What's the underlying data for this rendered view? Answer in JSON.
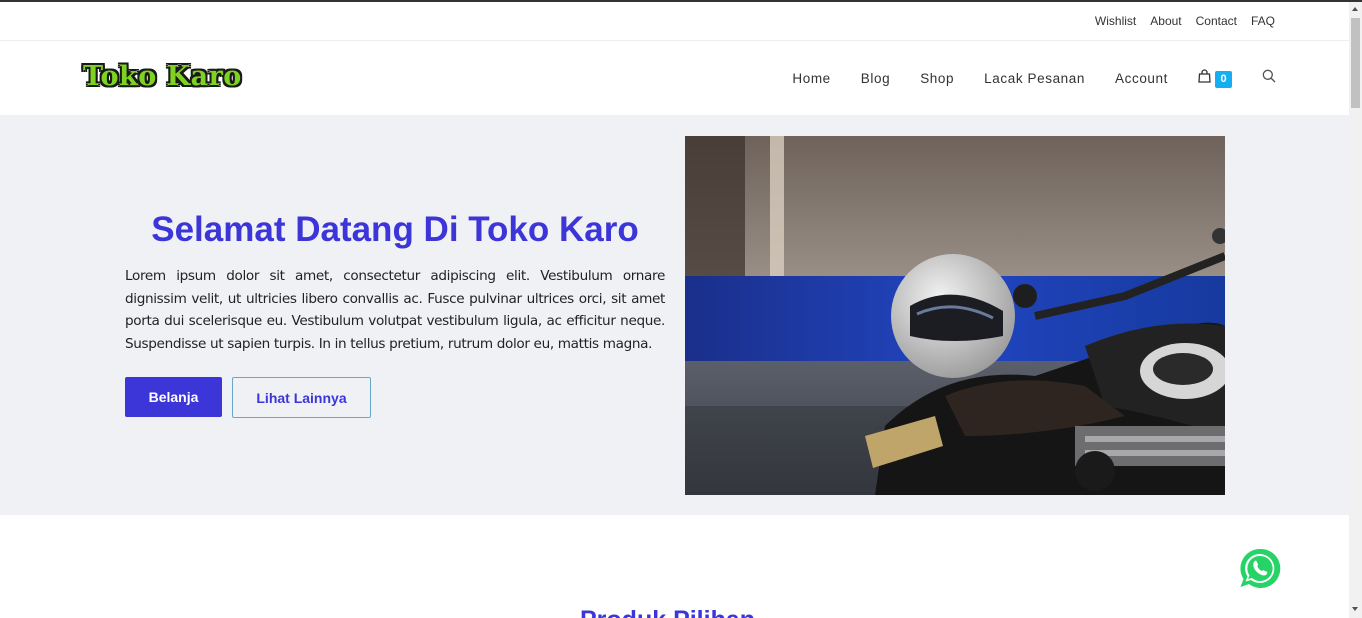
{
  "topbar": {
    "links": [
      "Wishlist",
      "About",
      "Contact",
      "FAQ"
    ]
  },
  "header": {
    "logo_text": "Toko Karo",
    "nav": [
      "Home",
      "Blog",
      "Shop",
      "Lacak Pesanan",
      "Account"
    ],
    "cart_count": "0",
    "icons": {
      "cart": "shopping-bag-icon",
      "search": "search-icon"
    }
  },
  "hero": {
    "title": "Selamat Datang Di Toko Karo",
    "text": "Lorem ipsum dolor sit amet, consectetur adipiscing elit. Vestibulum ornare dignissim velit, ut ultricies libero convallis ac. Fusce pulvinar ultrices orci, sit amet porta dui scelerisque eu. Vestibulum volutpat vestibulum ligula, ac efficitur neque. Suspendisse ut sapien turpis. In in tellus pretium, rutrum dolor eu, mattis magna.",
    "primary_button": "Belanja",
    "secondary_button": "Lihat Lainnya"
  },
  "section": {
    "title": "Produk Pilihan"
  },
  "colors": {
    "accent": "#3c35d8",
    "cart_badge": "#13aff0",
    "hero_bg": "#f0f1f5",
    "whatsapp": "#25d366"
  }
}
